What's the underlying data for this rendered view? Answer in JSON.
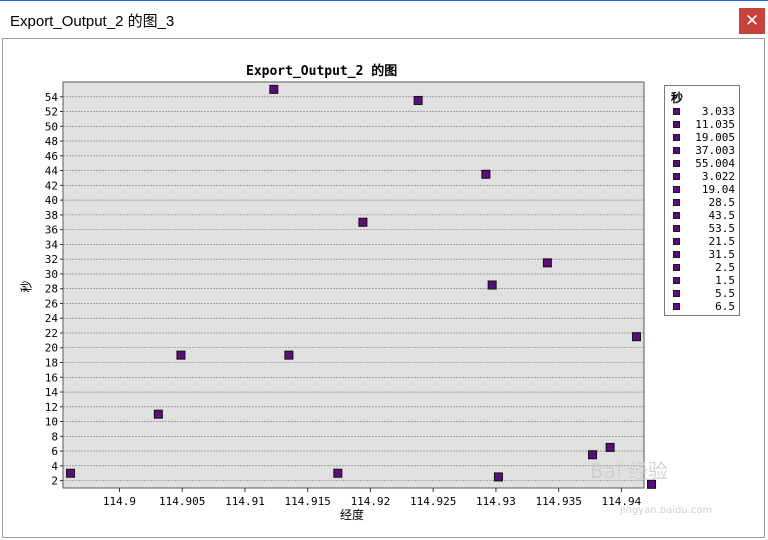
{
  "window": {
    "title": "Export_Output_2 的图_3",
    "close_label": "✕"
  },
  "chart_data": {
    "type": "scatter",
    "title": "Export_Output_2 的图",
    "xlabel": "经度",
    "ylabel": "秒",
    "xlim": [
      114.8955,
      114.9418
    ],
    "ylim": [
      1,
      56
    ],
    "xticks": [
      "114.9",
      "114.905",
      "114.91",
      "114.915",
      "114.92",
      "114.925",
      "114.93",
      "114.935",
      "114.94"
    ],
    "yticks": [
      "2",
      "4",
      "6",
      "8",
      "10",
      "12",
      "14",
      "16",
      "18",
      "20",
      "22",
      "24",
      "26",
      "28",
      "30",
      "32",
      "34",
      "36",
      "38",
      "40",
      "42",
      "44",
      "46",
      "48",
      "50",
      "52",
      "54"
    ],
    "grid": true,
    "marker_color": "#5b0d7e",
    "background": "#e0e0e0",
    "legend_title": "秒",
    "legend_position": "right",
    "legend": [
      "3.033",
      "11.035",
      "19.005",
      "37.003",
      "55.004",
      "3.022",
      "19.04",
      "28.5",
      "43.5",
      "53.5",
      "21.5",
      "31.5",
      "2.5",
      "1.5",
      "5.5",
      "6.5"
    ],
    "points": [
      {
        "x": 114.8961,
        "y": 3.0
      },
      {
        "x": 114.9031,
        "y": 11.0
      },
      {
        "x": 114.9049,
        "y": 19.0
      },
      {
        "x": 114.9123,
        "y": 55.0
      },
      {
        "x": 114.9135,
        "y": 19.0
      },
      {
        "x": 114.9174,
        "y": 3.0
      },
      {
        "x": 114.9194,
        "y": 37.0
      },
      {
        "x": 114.9238,
        "y": 53.5
      },
      {
        "x": 114.9292,
        "y": 43.5
      },
      {
        "x": 114.9297,
        "y": 28.5
      },
      {
        "x": 114.9302,
        "y": 2.5
      },
      {
        "x": 114.9341,
        "y": 31.5
      },
      {
        "x": 114.9377,
        "y": 5.5
      },
      {
        "x": 114.9391,
        "y": 6.5
      },
      {
        "x": 114.9412,
        "y": 21.5
      },
      {
        "x": 114.9424,
        "y": 1.5
      }
    ]
  },
  "watermark": {
    "text": "Bai 经验",
    "url": "jingyan.baidu.com"
  }
}
